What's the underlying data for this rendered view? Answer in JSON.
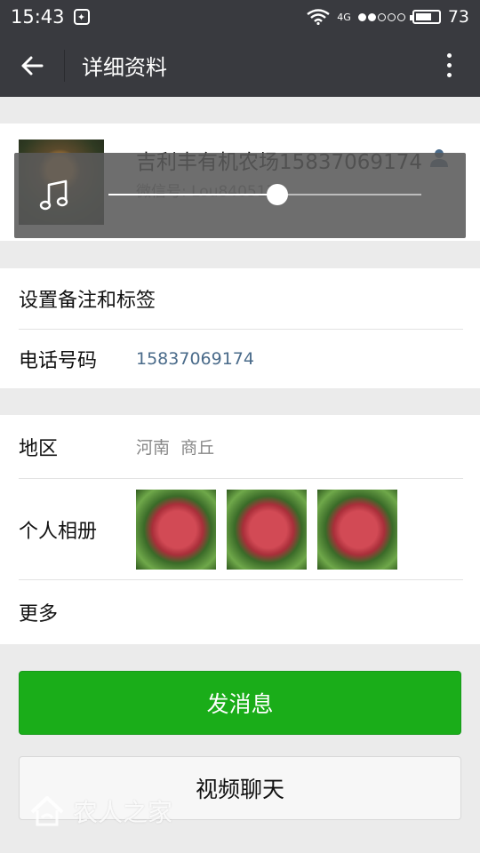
{
  "status_bar": {
    "time": "15:43",
    "network": "4G",
    "battery": "73"
  },
  "header": {
    "title": "详细资料"
  },
  "profile": {
    "name": "吉利丰有机农场15837069174",
    "wechat_id": "微信号: Lou840517"
  },
  "music_player": {
    "progress": 0.54
  },
  "info": {
    "remark_label": "设置备注和标签",
    "phone_label": "电话号码",
    "phone_value": "15837069174",
    "region_label": "地区",
    "region_value": "河南  商丘",
    "album_label": "个人相册",
    "more_label": "更多"
  },
  "buttons": {
    "send": "发消息",
    "video": "视频聊天"
  },
  "watermark": {
    "text": "农人之家"
  },
  "colors": {
    "header_bg": "#393a3f",
    "send_green": "#1aad19",
    "link_blue": "#4a6b8a"
  }
}
